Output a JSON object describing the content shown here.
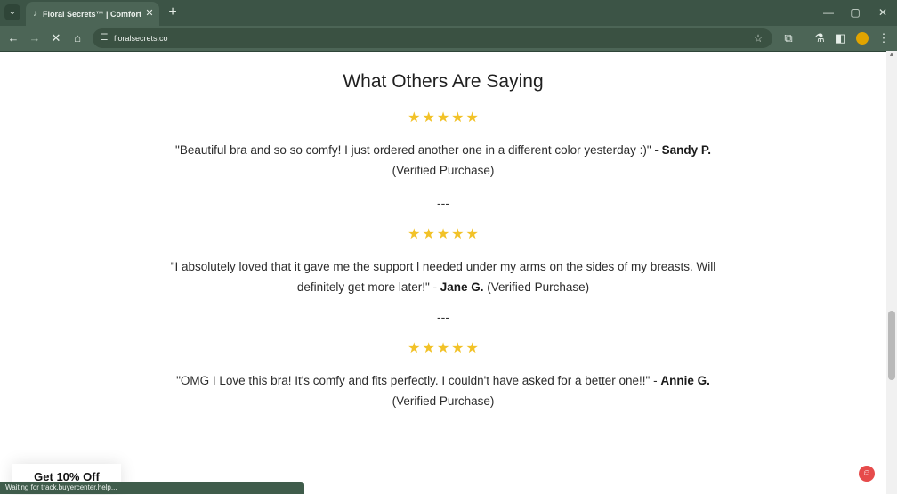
{
  "browser": {
    "tab_title": "Floral Secrets™ | Comfort Rose",
    "url": "floralsecrets.co",
    "status_text": "Waiting for track.buyercenter.help...",
    "icons": {
      "tab_search": "chevron-down-icon",
      "favicon": "music-note-icon",
      "tab_close": "close-icon",
      "new_tab": "plus-icon",
      "back": "back-arrow-icon",
      "forward": "forward-arrow-icon",
      "stop": "stop-icon",
      "home": "home-icon",
      "site_info": "tune-icon",
      "bookmark": "star-icon",
      "extensions": "puzzle-icon",
      "labs": "flask-icon",
      "side_panel": "side-panel-icon",
      "profile": "avatar-icon",
      "menu": "more-vertical-icon",
      "minimize": "minimize-icon",
      "maximize": "maximize-icon",
      "close_window": "close-icon"
    }
  },
  "page": {
    "heading": "What Others Are Saying",
    "divider_text": "---",
    "reviews": [
      {
        "quote": "\"Beautiful bra and so so comfy! I just ordered another one in a different color yesterday :)\"",
        "separator": " - ",
        "author": "Sandy P.",
        "suffix": "(Verified Purchase)",
        "rating": "★★★★★"
      },
      {
        "quote": "\"I absolutely loved that it gave me the support l needed under my arms on the sides of my breasts. Will definitely get more later!\"",
        "separator": " - ",
        "author": "Jane G.",
        "suffix": "(Verified Purchase)",
        "rating": "★★★★★"
      },
      {
        "quote": "\"OMG I Love this bra! It's comfy and fits perfectly. I couldn't have asked for a better one!!\"",
        "separator": " - ",
        "author": "Annie G.",
        "suffix": "(Verified Purchase)",
        "rating": "★★★★★"
      }
    ],
    "discount_label": "Get 10% Off"
  },
  "colors": {
    "browser_frame": "#3c5446",
    "toolbar": "#4c6556",
    "stars": "#f2c228",
    "status_bar": "#3f5c4b",
    "chat_button": "#e64b4b"
  }
}
